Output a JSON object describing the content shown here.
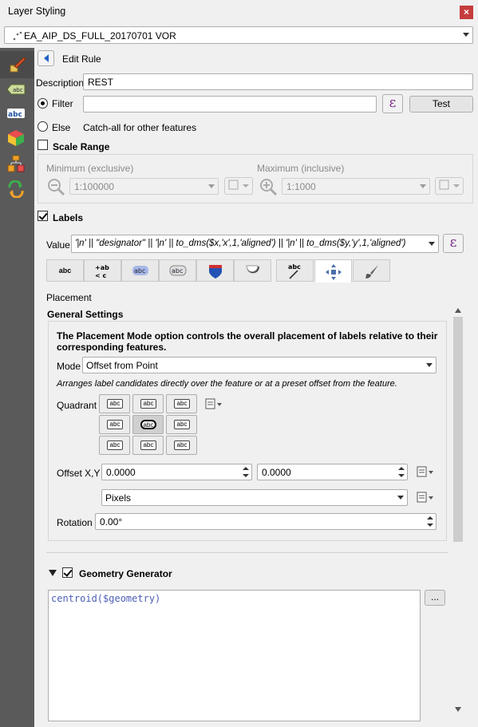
{
  "window": {
    "title": "Layer Styling",
    "close_label": "×"
  },
  "layer_combo": {
    "value": "EA_AIP_DS_FULL_20170701 VOR"
  },
  "sidebar": {
    "items": [
      {
        "icon": "paintbrush-icon"
      },
      {
        "icon": "label-abc-icon"
      },
      {
        "icon": "abc-text-icon"
      },
      {
        "icon": "3d-cube-icon"
      },
      {
        "icon": "diagram-icon"
      },
      {
        "icon": "history-icon"
      }
    ]
  },
  "edit_rule": {
    "title": "Edit Rule"
  },
  "description": {
    "label": "Description",
    "value": "REST"
  },
  "filter": {
    "label": "Filter",
    "value": "",
    "test_label": "Test"
  },
  "else": {
    "label": "Else",
    "hint": "Catch-all for other features"
  },
  "scale_range": {
    "label": "Scale Range",
    "min_label": "Minimum (exclusive)",
    "min_value": "1:100000",
    "max_label": "Maximum (inclusive)",
    "max_value": "1:1000"
  },
  "labels": {
    "label": "Labels",
    "value_label": "Value",
    "value_expr": "'|n' || \"designator\" || '|n' || to_dms($x,'x',1,'aligned') || '|n' || to_dms($y,'y',1,'aligned')"
  },
  "tabs": [
    {
      "name": "text",
      "text": "abc"
    },
    {
      "name": "formatting",
      "text": "+ab <c"
    },
    {
      "name": "buffer",
      "text": "abc"
    },
    {
      "name": "background",
      "text": "abc"
    },
    {
      "name": "shadow",
      "text": ""
    },
    {
      "name": "callouts",
      "text": ""
    },
    {
      "name": "callout-line",
      "text": "abc"
    },
    {
      "name": "placement",
      "text": ""
    },
    {
      "name": "rendering",
      "text": ""
    }
  ],
  "placement": {
    "section_label": "Placement",
    "general_settings": "General Settings",
    "info": "The Placement Mode option controls the overall placement of labels relative to their corresponding features.",
    "mode_label": "Mode",
    "mode_value": "Offset from Point",
    "mode_desc": "Arranges label candidates directly over the feature or at a preset offset from the feature.",
    "quadrant_label": "Quadrant",
    "quadrant_text": "abc",
    "quadrant_selected": 4,
    "offset_label": "Offset X,Y",
    "offset_x": "0.0000",
    "offset_y": "0.0000",
    "units_value": "Pixels",
    "rotation_label": "Rotation",
    "rotation_value": "0.00°"
  },
  "geometry_generator": {
    "label": "Geometry Generator",
    "expression": "centroid($geometry)",
    "more_label": "..."
  }
}
